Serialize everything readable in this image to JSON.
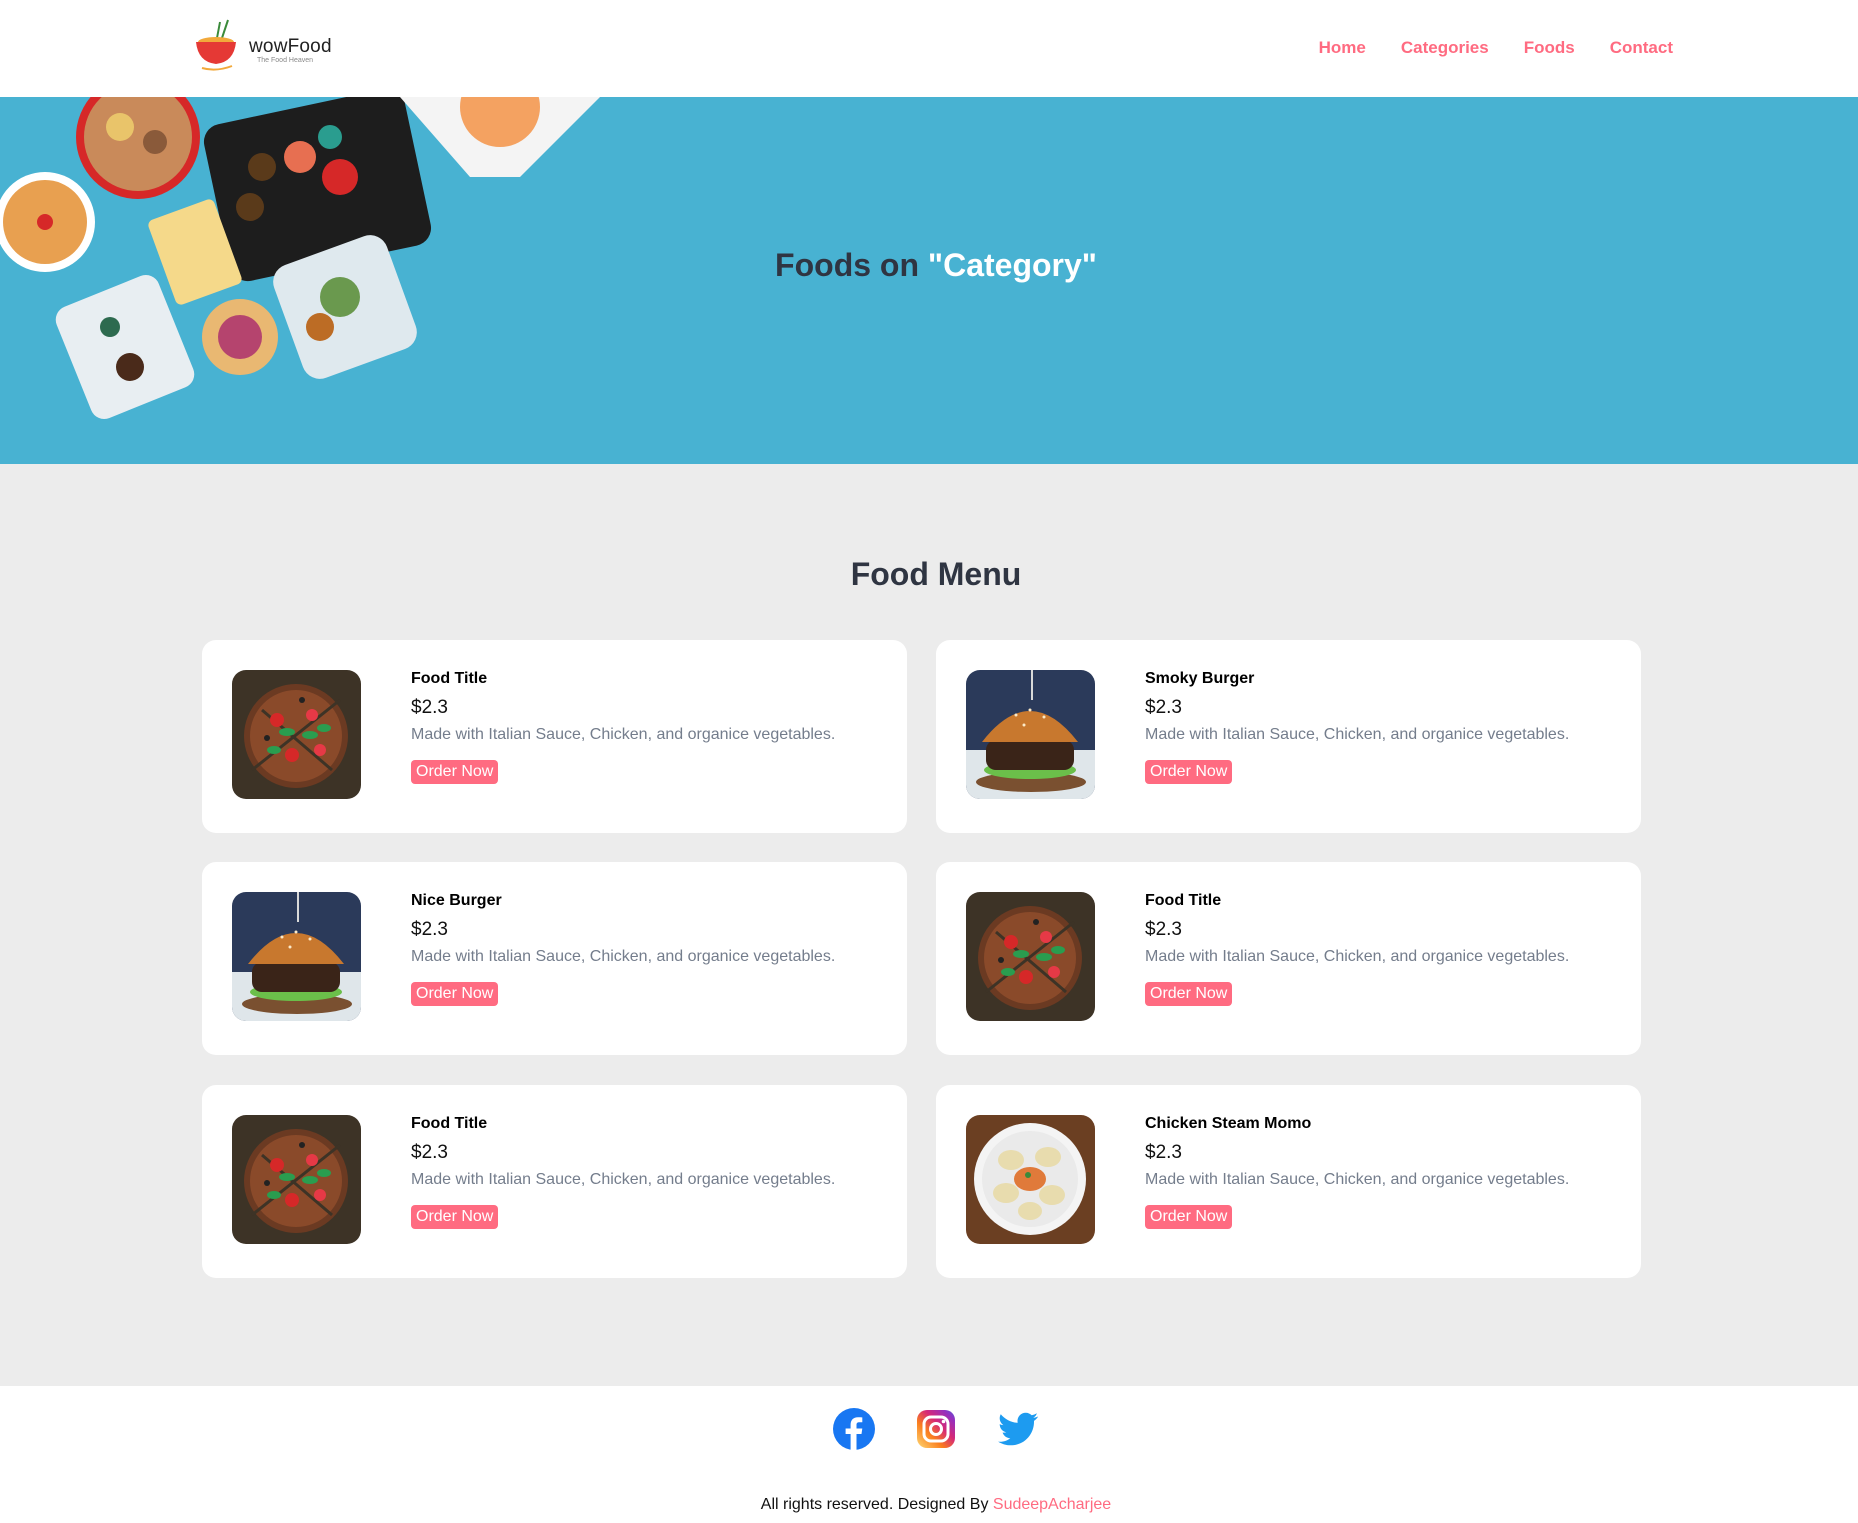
{
  "brand": {
    "name": "wowFood",
    "tagline": "The Food Heaven"
  },
  "nav": [
    {
      "label": "Home"
    },
    {
      "label": "Categories"
    },
    {
      "label": "Foods"
    },
    {
      "label": "Contact"
    }
  ],
  "hero": {
    "prefix": "Foods on ",
    "highlight": "\"Category\""
  },
  "menu": {
    "title": "Food Menu",
    "items": [
      {
        "title": "Food Title",
        "price": "$2.3",
        "description": "Made with Italian Sauce, Chicken, and organice vegetables.",
        "button": "Order Now",
        "image": "pizza"
      },
      {
        "title": "Smoky Burger",
        "price": "$2.3",
        "description": "Made with Italian Sauce, Chicken, and organice vegetables.",
        "button": "Order Now",
        "image": "burger"
      },
      {
        "title": "Nice Burger",
        "price": "$2.3",
        "description": "Made with Italian Sauce, Chicken, and organice vegetables.",
        "button": "Order Now",
        "image": "burger"
      },
      {
        "title": "Food Title",
        "price": "$2.3",
        "description": "Made with Italian Sauce, Chicken, and organice vegetables.",
        "button": "Order Now",
        "image": "pizza"
      },
      {
        "title": "Food Title",
        "price": "$2.3",
        "description": "Made with Italian Sauce, Chicken, and organice vegetables.",
        "button": "Order Now",
        "image": "pizza"
      },
      {
        "title": "Chicken Steam Momo",
        "price": "$2.3",
        "description": "Made with Italian Sauce, Chicken, and organice vegetables.",
        "button": "Order Now",
        "image": "momo"
      }
    ]
  },
  "footer": {
    "social": [
      "facebook-icon",
      "instagram-icon",
      "twitter-icon"
    ],
    "text": "All rights reserved. Designed By ",
    "author": "SudeepAcharjee"
  },
  "colors": {
    "accent": "#ff6b81",
    "hero_bg": "#48b2d2",
    "heading": "#2f3542",
    "page_bg": "#ececec"
  }
}
